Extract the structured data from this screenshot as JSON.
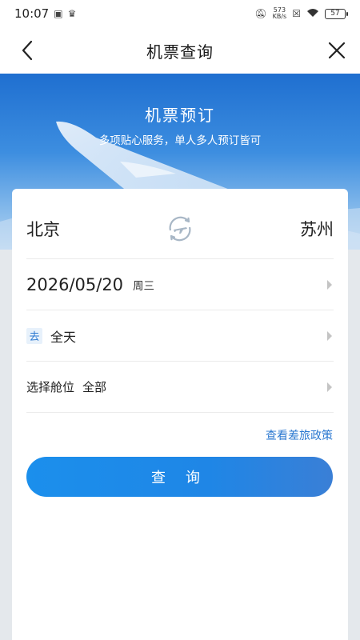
{
  "status_bar": {
    "time": "10:07",
    "net_speed_value": "573",
    "net_speed_unit": "KB/s",
    "battery": "57"
  },
  "nav": {
    "title": "机票查询"
  },
  "hero": {
    "title": "机票预订",
    "subtitle": "多项贴心服务，单人多人预订皆可"
  },
  "form": {
    "from_city": "北京",
    "to_city": "苏州",
    "date": "2026/05/20",
    "weekday": "周三",
    "trip_tag": "去",
    "time_range": "全天",
    "cabin_label": "选择舱位",
    "cabin_value": "全部",
    "policy_link": "查看差旅政策",
    "search_button": "查 询"
  },
  "colors": {
    "accent": "#1f86e6",
    "link": "#2b78d0"
  },
  "icons": [
    "back-arrow-icon",
    "close-icon",
    "swap-plane-icon",
    "chevron-right-icon"
  ]
}
